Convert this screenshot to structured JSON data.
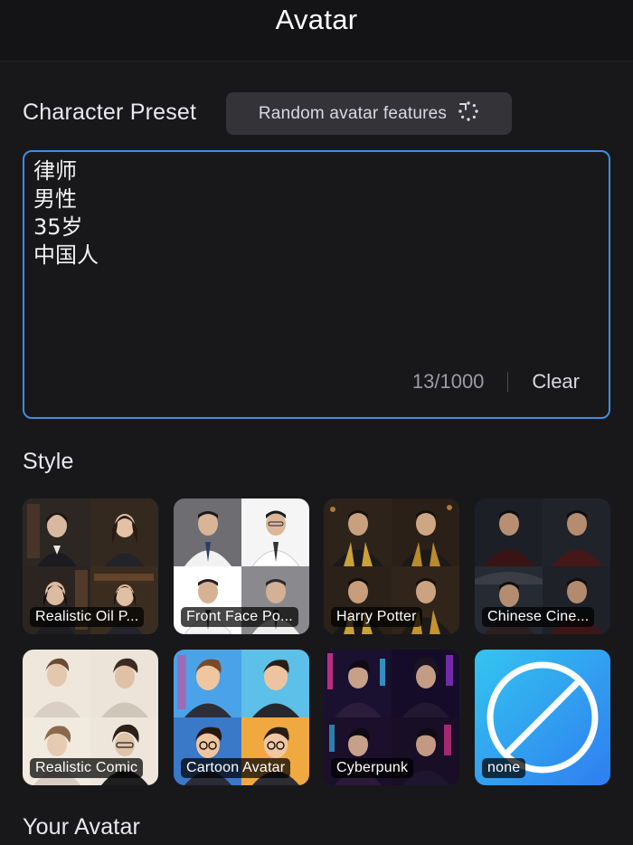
{
  "header": {
    "title": "Avatar"
  },
  "character_preset": {
    "label": "Character Preset",
    "random_button_label": "Random avatar features",
    "random_icon": "refresh-dotted-icon",
    "lines": [
      "律师",
      "男性",
      "35岁",
      "中国人"
    ],
    "char_count": "13/1000",
    "clear_label": "Clear"
  },
  "style": {
    "label": "Style",
    "selected_index": 0,
    "accent_color": "#3a8fe8",
    "options": [
      {
        "label": "Realistic Oil P...",
        "selected": true
      },
      {
        "label": "Front Face Po...",
        "selected": false
      },
      {
        "label": "Harry Potter",
        "selected": false
      },
      {
        "label": "Chinese Cine...",
        "selected": false
      },
      {
        "label": "Realistic Comic",
        "selected": false
      },
      {
        "label": "Cartoon Avatar",
        "selected": false
      },
      {
        "label": "Cyberpunk",
        "selected": false
      },
      {
        "label": "none",
        "selected": false,
        "icon": "prohibited-icon"
      }
    ]
  },
  "your_avatar": {
    "label": "Your Avatar"
  }
}
